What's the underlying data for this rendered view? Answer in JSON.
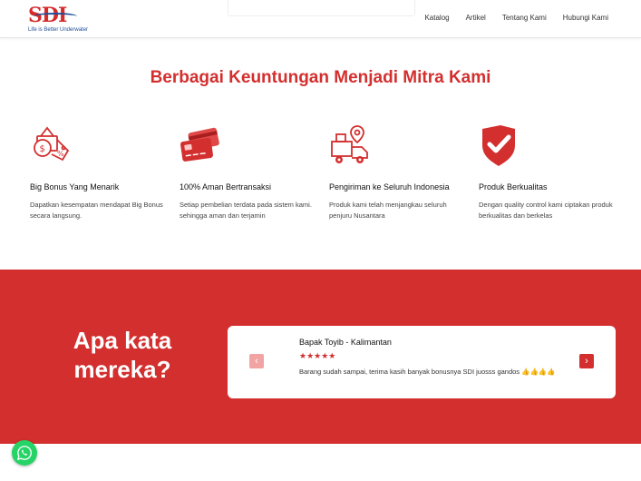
{
  "header": {
    "logo_text": "SDI",
    "tagline": "Life is Better Underwater",
    "nav": [
      "Katalog",
      "Artikel",
      "Tentang Kami",
      "Hubungi Kami"
    ]
  },
  "benefits": {
    "title": "Berbagai Keuntungan Menjadi Mitra Kami",
    "items": [
      {
        "icon": "gift-coin-icon",
        "title": "Big Bonus Yang Menarik",
        "desc": "Dapatkan kesempatan mendapat Big Bonus secara langsung."
      },
      {
        "icon": "credit-card-icon",
        "title": "100% Aman Bertransaksi",
        "desc": "Setiap pembelian terdata pada sistem kami. sehingga aman dan terjamin"
      },
      {
        "icon": "delivery-truck-icon",
        "title": "Pengiriman ke Seluruh Indonesia",
        "desc": "Produk kami telah menjangkau seluruh penjuru Nusantara"
      },
      {
        "icon": "shield-check-icon",
        "title": "Produk Berkualitas",
        "desc": "Dengan quality control kami ciptakan produk berkualitas dan berkelas"
      }
    ]
  },
  "testimonials": {
    "title_line1": "Apa kata",
    "title_line2": "mereka?",
    "name": "Bapak Toyib - Kalimantan",
    "stars": "★★★★★",
    "rating": 5,
    "text": "Barang sudah sampai, terima kasih banyak bonusnya SDI juosss gandos 👍👍👍👍"
  },
  "colors": {
    "accent": "#d32f2f",
    "whatsapp": "#25d366",
    "brand_blue": "#1f4e9a"
  }
}
